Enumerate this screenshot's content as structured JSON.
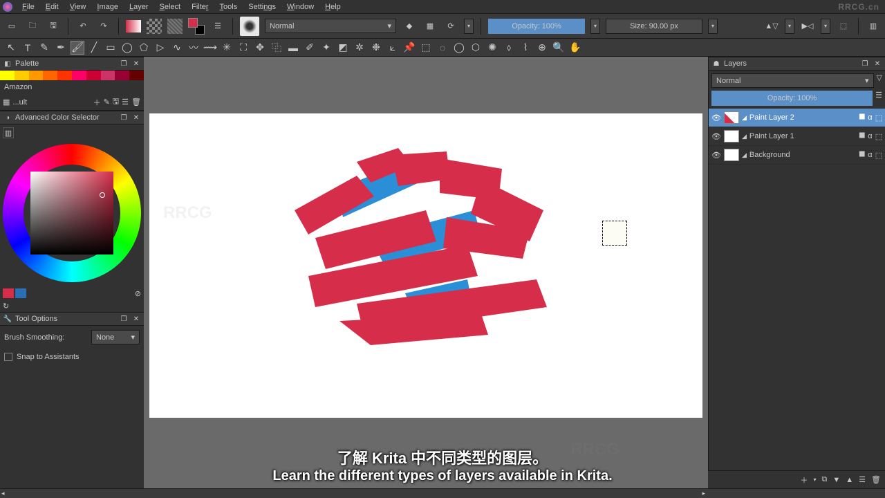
{
  "menu": {
    "file": "File",
    "edit": "Edit",
    "view": "View",
    "image": "Image",
    "layer": "Layer",
    "select": "Select",
    "filter": "Filter",
    "tools": "Tools",
    "settings": "Settings",
    "window": "Window",
    "help": "Help"
  },
  "toolbar": {
    "blend_mode": "Normal",
    "opacity_label": "Opacity: 100%",
    "size_label": "Size: 90.00 px"
  },
  "palette": {
    "title": "Palette",
    "name": "Amazon",
    "picker_label": "...ult",
    "colors": [
      "#ffff00",
      "#ffcc00",
      "#ff9900",
      "#ff6600",
      "#ff3300",
      "#ff0066",
      "#cc0033",
      "#990000",
      "#660000"
    ]
  },
  "color_selector": {
    "title": "Advanced Color Selector",
    "fg": "#d62e4a",
    "bg": "#2a6fb5"
  },
  "tool_options": {
    "title": "Tool Options",
    "smoothing_label": "Brush Smoothing:",
    "smoothing_value": "None",
    "snap_label": "Snap to Assistants"
  },
  "layers": {
    "title": "Layers",
    "blend_mode": "Normal",
    "opacity_label": "Opacity:  100%",
    "items": [
      {
        "name": "Paint Layer 2",
        "selected": true
      },
      {
        "name": "Paint Layer 1",
        "selected": false
      },
      {
        "name": "Background",
        "selected": false
      }
    ]
  },
  "subtitle": {
    "cn": "了解 Krita 中不同类型的图层。",
    "en": "Learn the different types of layers available in Krita."
  },
  "watermark": "RRCG.cn"
}
